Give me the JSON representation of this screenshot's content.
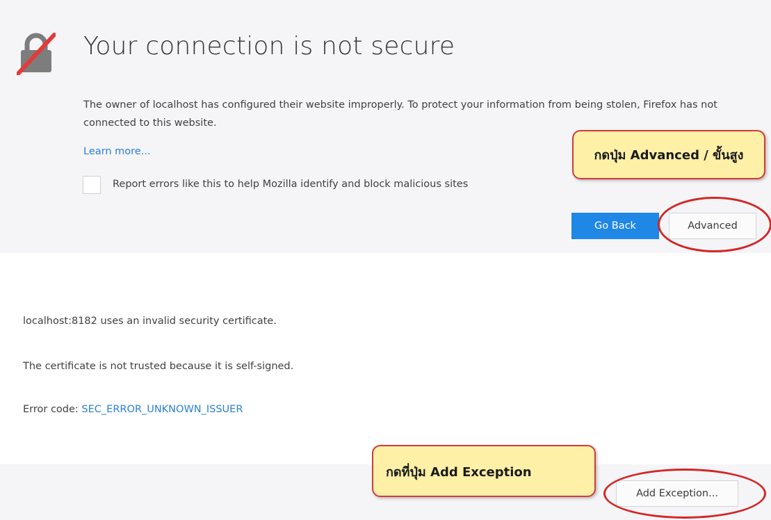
{
  "error_page": {
    "title": "Your connection is not secure",
    "description": "The owner of localhost has configured their website improperly. To protect your information from being stolen, Firefox has not connected to this website.",
    "learn_more": "Learn more...",
    "report_label": "Report errors like this to help Mozilla identify and block malicious sites",
    "report_checked": false,
    "go_back_label": "Go Back",
    "advanced_label": "Advanced"
  },
  "advanced_details": {
    "invalid_cert": "localhost:8182 uses an invalid security certificate.",
    "not_trusted": "The certificate is not trusted because it is self-signed.",
    "error_code_label": "Error code:",
    "error_code_value": "SEC_ERROR_UNKNOWN_ISSUER",
    "add_exception_label": "Add Exception..."
  },
  "annotations": {
    "callout_advanced": "กดปุ่ม Advanced / ขั้นสูง",
    "callout_add_exception": "กดที่ปุ่ม Add Exception"
  },
  "icons": {
    "lock": "broken-lock-icon"
  },
  "colors": {
    "accent_blue": "#1f87e6",
    "link_blue": "#2a7fd6",
    "annotation_red": "#d32626",
    "callout_fill": "#fff0a8",
    "panel_bg": "#f5f5f7"
  }
}
